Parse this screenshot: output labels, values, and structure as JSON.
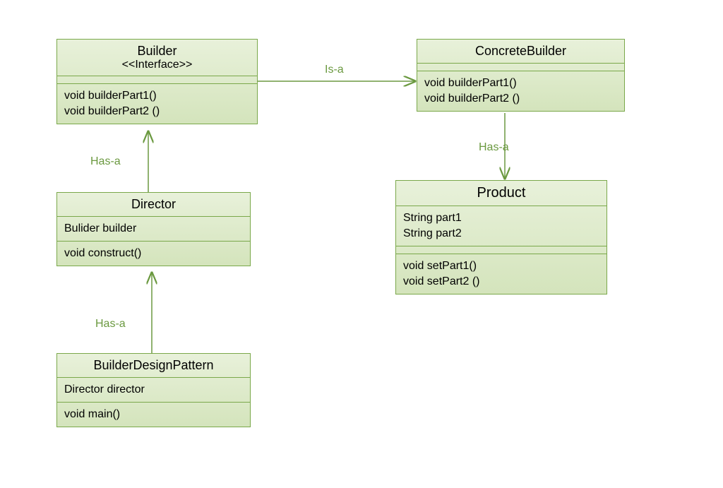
{
  "classes": {
    "builder": {
      "title": "Builder",
      "stereotype": "<<Interface>>",
      "methods": [
        "void builderPart1()",
        "void builderPart2 ()"
      ]
    },
    "concreteBuilder": {
      "title": "ConcreteBuilder",
      "methods": [
        "void builderPart1()",
        "void builderPart2 ()"
      ]
    },
    "director": {
      "title": "Director",
      "attributes": [
        "Bulider  builder"
      ],
      "methods": [
        "void construct()"
      ]
    },
    "builderDesignPattern": {
      "title": "BuilderDesignPattern",
      "attributes": [
        "Director  director"
      ],
      "methods": [
        "void main()"
      ]
    },
    "product": {
      "title": "Product",
      "attributes": [
        "String part1",
        "String part2"
      ],
      "methods": [
        "void setPart1()",
        "void setPart2 ()"
      ]
    }
  },
  "edges": {
    "isA": "Is-a",
    "hasA1": "Has-a",
    "hasA2": "Has-a",
    "hasA3": "Has-a"
  }
}
